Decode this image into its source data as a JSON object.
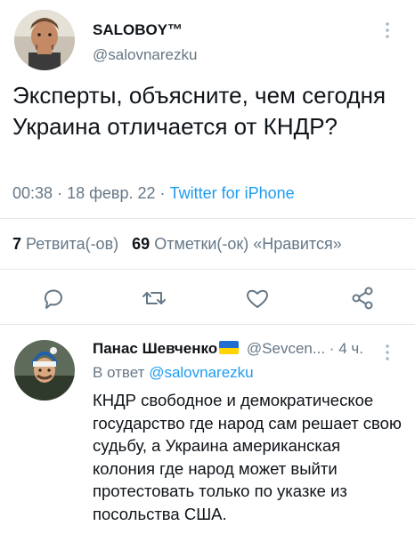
{
  "tweet": {
    "display_name": "SALOBOY™",
    "handle": "@salovnarezku",
    "text": "Эксперты, объясните, чем сегодня Украина отличается от КНДР?",
    "time": "00:38",
    "date": "18 февр. 22",
    "source": "Twitter for iPhone",
    "sep": "·"
  },
  "stats": {
    "retweets_count": "7",
    "retweets_label": "Ретвита(-ов)",
    "likes_count": "69",
    "likes_label": "Отметки(-ок) «Нравится»"
  },
  "actions": {
    "reply_icon": "reply-icon",
    "retweet_icon": "retweet-icon",
    "like_icon": "heart-icon",
    "share_icon": "share-icon"
  },
  "reply": {
    "display_name": "Панас Шевченко",
    "flag": "ukraine-flag",
    "handle": "@Sevcen...",
    "sep": "·",
    "time": "4 ч.",
    "in_reply_prefix": "В ответ",
    "in_reply_mention": "@salovnarezku",
    "text": "КНДР свободное и демократическое государство где народ сам решает свою судьбу, а Украина американская колония где народ может выйти протестовать только по указке из посольства США."
  },
  "colors": {
    "link": "#1d9bf0",
    "secondary": "#657786",
    "primary_text": "#0f1419",
    "divider": "#e1e8ed"
  }
}
